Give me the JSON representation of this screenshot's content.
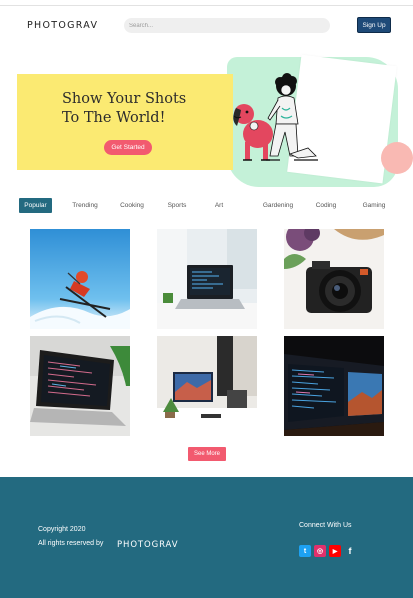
{
  "header": {
    "logo": "PHOTOGRAV",
    "search_placeholder": "Search...",
    "signup_label": "Sign Up"
  },
  "hero": {
    "title_line1": "Show Your Shots",
    "title_line2": "To The World!",
    "cta_label": "Get Started"
  },
  "tabs": [
    {
      "label": "Popular",
      "active": true
    },
    {
      "label": "Trending"
    },
    {
      "label": "Cooking"
    },
    {
      "label": "Sports"
    },
    {
      "label": "Art"
    },
    {
      "label": "Gardening"
    },
    {
      "label": "Coding"
    },
    {
      "label": "Gaming"
    }
  ],
  "gallery": {
    "photos": [
      {
        "subject": "skier"
      },
      {
        "subject": "laptop-desk"
      },
      {
        "subject": "camera"
      },
      {
        "subject": "laptop-code"
      },
      {
        "subject": "monitor-desk"
      },
      {
        "subject": "dark-monitor-code"
      }
    ],
    "see_more_label": "See More"
  },
  "footer": {
    "copyright": "Copyright 2020",
    "rights": "All rights reserved by",
    "logo": "PHOTOGRAV",
    "connect_label": "Connect With Us",
    "social": [
      {
        "icon": "twitter-icon",
        "glyph": "t",
        "color": "#1da1f2"
      },
      {
        "icon": "instagram-icon",
        "glyph": "◎",
        "color": "#e1306c"
      },
      {
        "icon": "youtube-icon",
        "glyph": "▶",
        "color": "#ff0000"
      },
      {
        "icon": "facebook-icon",
        "glyph": "f",
        "color": "#236a80"
      }
    ]
  },
  "colors": {
    "primary": "#236a80",
    "accent": "#f25a6f",
    "hero_yellow": "#fbea72",
    "hero_green": "#c4f1d8",
    "signup_bg": "#1e4a78"
  }
}
